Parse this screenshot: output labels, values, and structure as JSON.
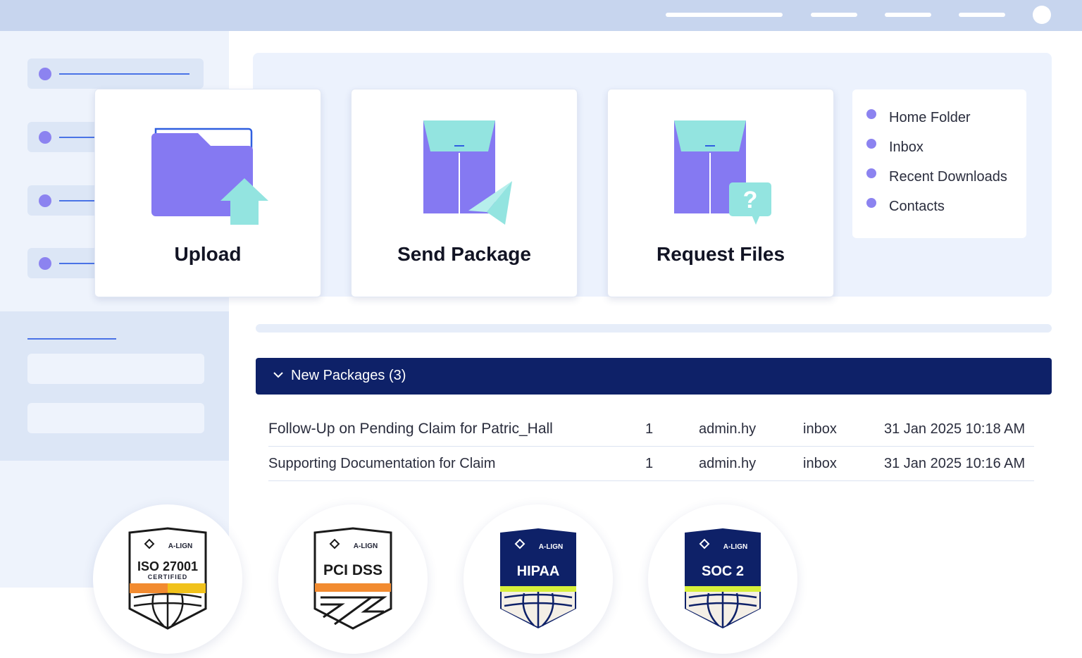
{
  "actions": [
    {
      "label": "Upload",
      "icon": "folder-upload-icon"
    },
    {
      "label": "Send Package",
      "icon": "package-send-icon"
    },
    {
      "label": "Request Files",
      "icon": "package-request-icon"
    }
  ],
  "quick_links": [
    "Home Folder",
    "Inbox",
    "Recent Downloads",
    "Contacts"
  ],
  "packages": {
    "header": "New Packages (3)",
    "rows": [
      {
        "subject": "Follow-Up on Pending Claim for Patric_Hall",
        "files": "1",
        "sender": "admin.hy",
        "folder": "inbox",
        "date": "31 Jan 2025 10:18 AM"
      },
      {
        "subject": "Supporting Documentation for Claim",
        "files": "1",
        "sender": "admin.hy",
        "folder": "inbox",
        "date": "31 Jan 2025 10:16 AM"
      }
    ]
  },
  "badges": [
    {
      "brand": "A-LIGN",
      "title": "ISO 27001",
      "subtitle": "CERTIFIED"
    },
    {
      "brand": "A-LIGN",
      "title": "PCI DSS",
      "subtitle": ""
    },
    {
      "brand": "A-LIGN",
      "title": "HIPAA",
      "subtitle": ""
    },
    {
      "brand": "A-LIGN",
      "title": "SOC 2",
      "subtitle": ""
    }
  ],
  "colors": {
    "accent_purple": "#8c83f0",
    "accent_teal": "#93e4e0",
    "navy": "#0e2168",
    "link_blue": "#4a73e6"
  }
}
